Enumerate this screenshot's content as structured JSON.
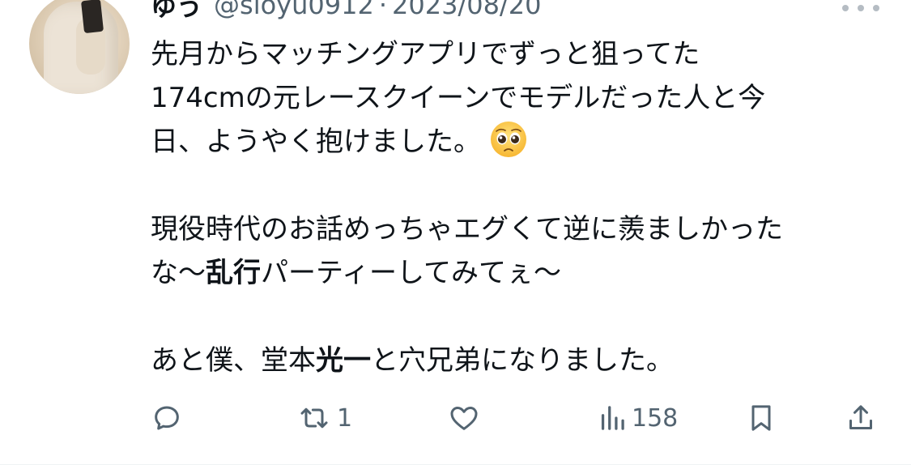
{
  "tweet": {
    "author_name": "ゆう",
    "author_handle": "@sioyu0912",
    "separator": "·",
    "date": "2023/08/20",
    "lines": {
      "l1": "先月からマッチングアプリでずっと狙ってた",
      "l2": "174cmの元レースクイーンでモデルだった人と今",
      "l3": "日、ようやく抱けました。",
      "l4": "現役時代のお話めっちゃエグくて逆に羨ましかった",
      "l5a": "な〜",
      "l5b": "乱行",
      "l5c": "パーティーしてみてぇ〜",
      "l6a": "あと僕、堂本",
      "l6b": "光一",
      "l6c": "と穴兄弟になりました。"
    },
    "emoji": "pleading-face"
  },
  "actions": {
    "reply_icon": "reply-icon",
    "retweet_icon": "retweet-icon",
    "retweet_count": "1",
    "like_icon": "heart-icon",
    "views_icon": "views-icon",
    "views_count": "158",
    "bookmark_icon": "bookmark-icon",
    "share_icon": "share-icon"
  },
  "colors": {
    "text": "#0f1419",
    "secondary": "#536471",
    "divider": "#eff3f4"
  }
}
